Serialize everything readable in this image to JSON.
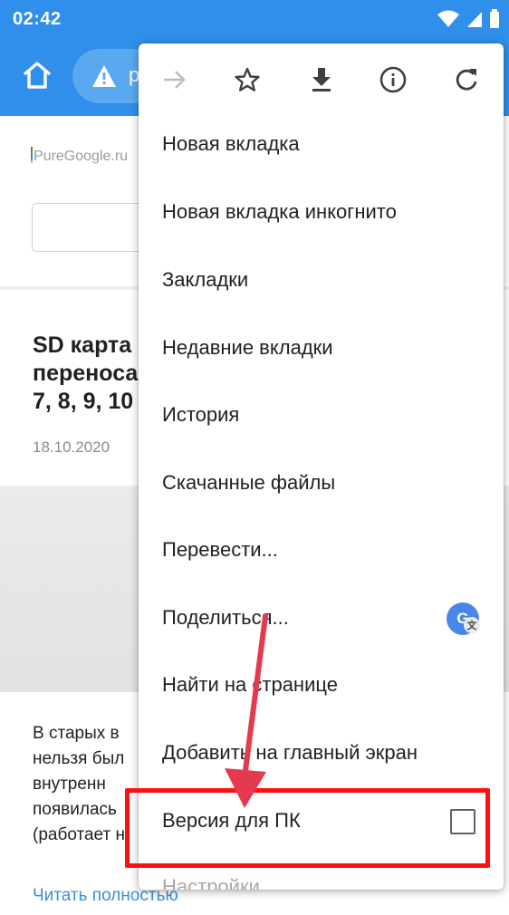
{
  "status_bar": {
    "time": "02:42",
    "icons": [
      "wifi-icon",
      "signal-icon",
      "battery-icon"
    ]
  },
  "toolbar": {
    "home_icon": "home-icon",
    "security_icon": "warning-icon",
    "url_text": "p"
  },
  "page": {
    "site_logo": "PureGoogle.ru",
    "article_title_lines": [
      "SD карта",
      "переноса",
      "7, 8, 9, 10"
    ],
    "article_date": "18.10.2020",
    "article_text_lines": [
      "В старых в",
      "нельзя был",
      "внутренн",
      "появилась",
      "(работает н"
    ],
    "read_more": "Читать полностью"
  },
  "menu": {
    "icons": [
      "forward-icon",
      "bookmark-star-icon",
      "download-icon",
      "info-icon",
      "refresh-icon"
    ],
    "items": [
      {
        "label": "Новая вкладка"
      },
      {
        "label": "Новая вкладка инкогнито"
      },
      {
        "label": "Закладки"
      },
      {
        "label": "Недавние вкладки"
      },
      {
        "label": "История"
      },
      {
        "label": "Скачанные файлы"
      },
      {
        "label": "Перевести..."
      },
      {
        "label": "Поделиться..."
      },
      {
        "label": "Найти на странице"
      },
      {
        "label": "Добавить на главный экран"
      },
      {
        "label": "Версия для ПК"
      }
    ],
    "cut_item_label": "Настройки",
    "share_badge": {
      "letter": "G",
      "sub": "文"
    },
    "desktop_checkbox_checked": false
  },
  "colors": {
    "toolbar": "#2f8fea",
    "link": "#3b8fd9",
    "annotation": "#ff1010",
    "arrow": "#e5394f"
  }
}
